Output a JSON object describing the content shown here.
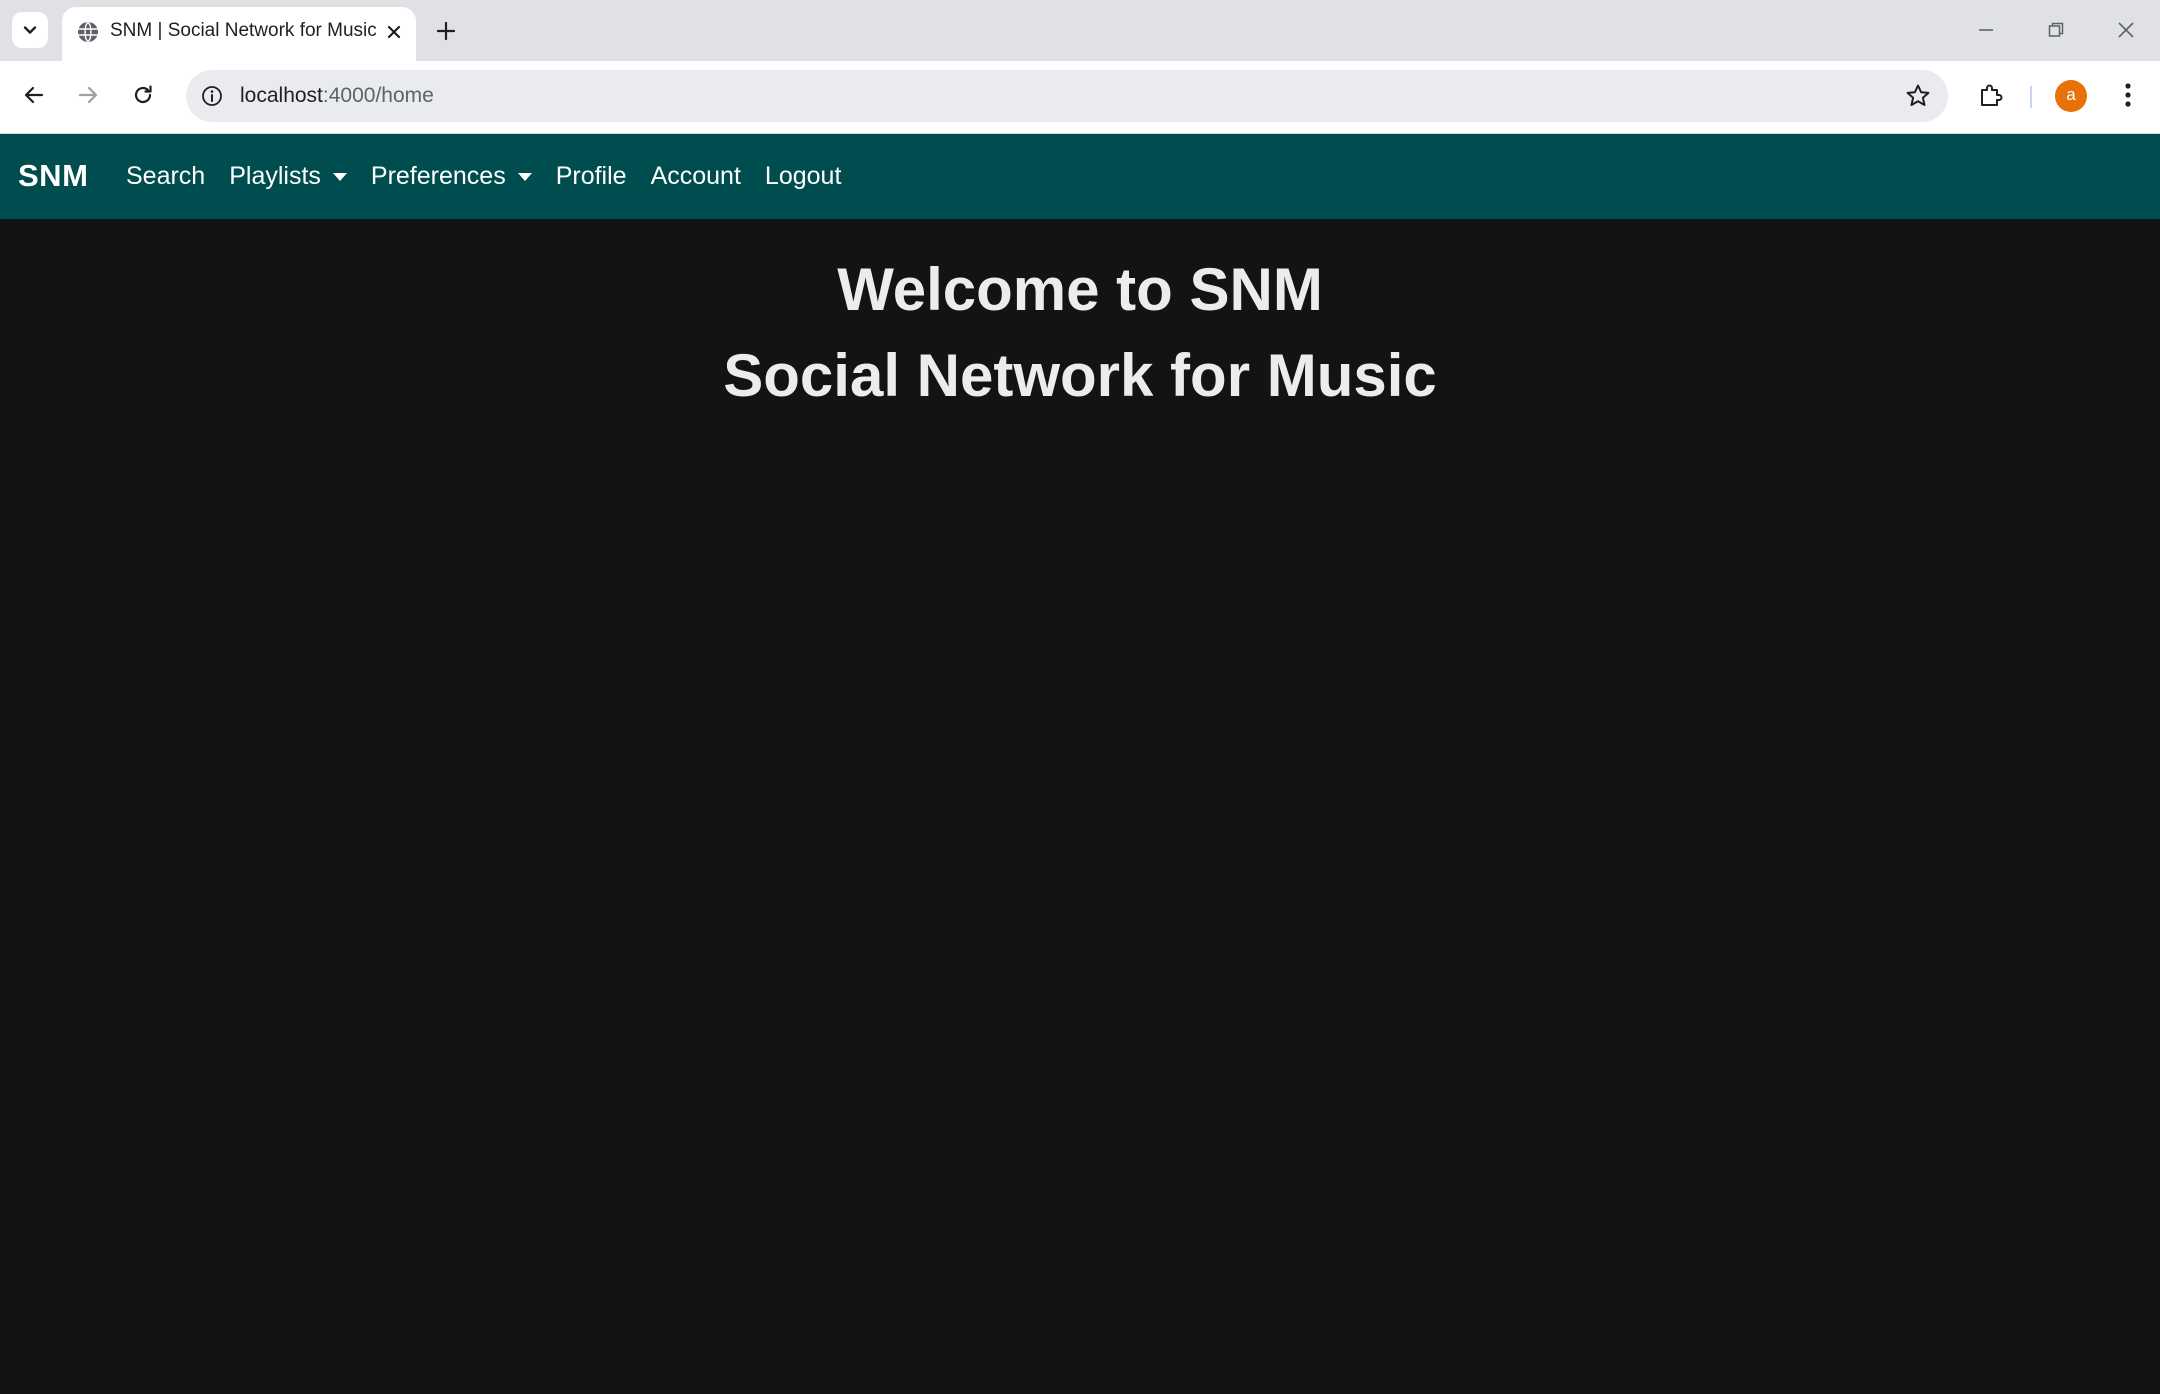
{
  "browser": {
    "tab": {
      "title": "SNM | Social Network for Music",
      "favicon": "globe-icon"
    },
    "address_bar": {
      "host": "localhost",
      "path": ":4000/home"
    },
    "profile_initial": "a",
    "colors": {
      "tabstrip": "#dfe1e5",
      "avatar": "#e8710a"
    }
  },
  "site": {
    "brand": "SNM",
    "nav": {
      "search": "Search",
      "playlists": "Playlists",
      "preferences": "Preferences",
      "profile": "Profile",
      "account": "Account",
      "logout": "Logout"
    },
    "colors": {
      "navbar": "#004d4f",
      "background": "#131313",
      "heading": "#ececec"
    }
  },
  "main": {
    "heading_line1": "Welcome to SNM",
    "heading_line2": "Social Network for Music"
  }
}
